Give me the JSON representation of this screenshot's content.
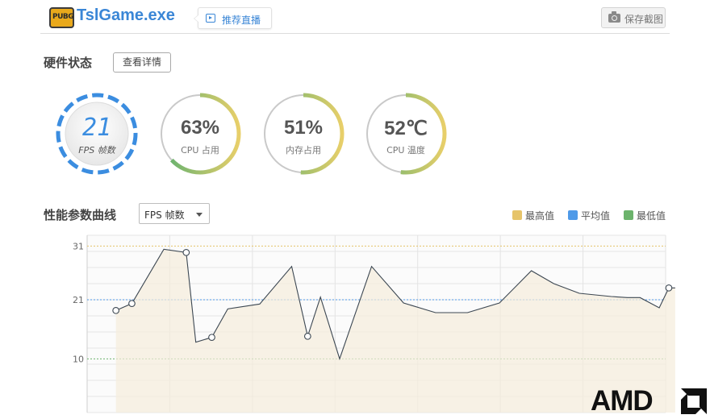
{
  "header": {
    "logo_text": "PUBG",
    "title": "TslGame.exe",
    "live_label": "推荐直播",
    "save_label": "保存截图"
  },
  "hardware": {
    "section_title": "硬件状态",
    "detail_label": "查看详情",
    "gauges": [
      {
        "value": "21",
        "label": "FPS 帧数",
        "percent": 1.0
      },
      {
        "value": "63%",
        "label": "CPU 占用",
        "percent": 0.63
      },
      {
        "value": "51%",
        "label": "内存占用",
        "percent": 0.51
      },
      {
        "value": "52℃",
        "label": "CPU 温度",
        "percent": 0.52
      }
    ]
  },
  "performance": {
    "section_title": "性能参数曲线",
    "selected_metric": "FPS 帧数",
    "legend": [
      {
        "label": "最高值",
        "color": "#e6c46a"
      },
      {
        "label": "平均值",
        "color": "#4f9ae8"
      },
      {
        "label": "最低值",
        "color": "#6cb36c"
      }
    ]
  },
  "chart_data": {
    "type": "line",
    "series": [
      {
        "x": [
          0,
          0.5,
          1.5,
          2.2,
          2.5,
          3,
          3.5,
          4.5,
          5.5,
          6,
          6.4,
          7,
          8,
          9,
          10,
          11,
          12,
          13,
          13.7,
          14.5,
          15.5,
          16,
          16.4,
          17,
          17.3,
          17.5
        ],
        "y": [
          19,
          20.3,
          30.4,
          29.8,
          13.1,
          14,
          19.3,
          20.2,
          27.2,
          14.2,
          21.5,
          10,
          27.2,
          20.4,
          18.6,
          18.6,
          20.4,
          26.4,
          24,
          22.2,
          21.6,
          21.4,
          21.4,
          19.5,
          23.2,
          23.2
        ],
        "markers": [
          0,
          1,
          3,
          5,
          9,
          24
        ]
      }
    ],
    "reference_lines": {
      "max": 31,
      "avg": 21,
      "min": 10
    },
    "yticks": [
      31,
      21,
      10
    ],
    "ylim": [
      0,
      33
    ],
    "xlim": [
      -0.9,
      17.2
    ],
    "grid": true,
    "legend_position": "top-right"
  },
  "brand": {
    "amd_text": "AMD"
  }
}
